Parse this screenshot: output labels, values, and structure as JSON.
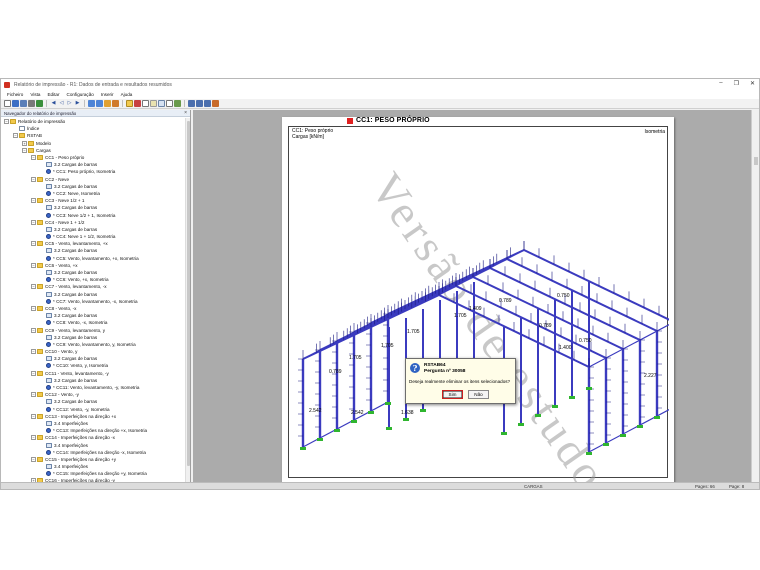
{
  "window": {
    "title": "Relatório de impressão - R1: Dados de entrada e resultados resumidos",
    "controls": [
      "–",
      "❐",
      "✕"
    ]
  },
  "menu": [
    "Ficheiro",
    "Vista",
    "Editar",
    "Configuração",
    "Inserir",
    "Ajuda"
  ],
  "navigator": {
    "title": "Navegador do relatório de impressão",
    "close": "×",
    "tree": [
      {
        "level": 0,
        "toggle": "−",
        "icon": "folder",
        "label": "Relatório de impressão"
      },
      {
        "level": 1,
        "toggle": "",
        "icon": "doc",
        "label": "Índice"
      },
      {
        "level": 1,
        "toggle": "−",
        "icon": "folder",
        "label": "RSTAB"
      },
      {
        "level": 2,
        "toggle": "+",
        "icon": "folder",
        "label": "Modelo"
      },
      {
        "level": 2,
        "toggle": "−",
        "icon": "folder",
        "label": "Cargas"
      },
      {
        "level": 3,
        "toggle": "−",
        "icon": "folder",
        "label": "CC1 - Peso próprio"
      },
      {
        "level": 4,
        "toggle": "",
        "icon": "table",
        "label": "3.2 Cargas de barras"
      },
      {
        "level": 4,
        "toggle": "",
        "icon": "iso",
        "label": "* CC1: Peso próprio, Isometria"
      },
      {
        "level": 3,
        "toggle": "−",
        "icon": "folder",
        "label": "CC2 - Neve"
      },
      {
        "level": 4,
        "toggle": "",
        "icon": "table",
        "label": "3.2 Cargas de barras"
      },
      {
        "level": 4,
        "toggle": "",
        "icon": "iso",
        "label": "* CC2: Neve, Isometria"
      },
      {
        "level": 3,
        "toggle": "−",
        "icon": "folder",
        "label": "CC3 - Neve 1/2 + 1"
      },
      {
        "level": 4,
        "toggle": "",
        "icon": "table",
        "label": "3.2 Cargas de barras"
      },
      {
        "level": 4,
        "toggle": "",
        "icon": "iso",
        "label": "* CC3: Neve 1/2 + 1, Isometria"
      },
      {
        "level": 3,
        "toggle": "−",
        "icon": "folder",
        "label": "CC4 - Neve 1 + 1/2"
      },
      {
        "level": 4,
        "toggle": "",
        "icon": "table",
        "label": "3.2 Cargas de barras"
      },
      {
        "level": 4,
        "toggle": "",
        "icon": "iso",
        "label": "* CC4: Neve 1 + 1/2, Isometria"
      },
      {
        "level": 3,
        "toggle": "−",
        "icon": "folder",
        "label": "CC5 - Vento, levantamento, +x"
      },
      {
        "level": 4,
        "toggle": "",
        "icon": "table",
        "label": "3.2 Cargas de barras"
      },
      {
        "level": 4,
        "toggle": "",
        "icon": "iso",
        "label": "* CC5: Vento, levantamento, +x, Isometria"
      },
      {
        "level": 3,
        "toggle": "−",
        "icon": "folder",
        "label": "CC6 - Vento, +x"
      },
      {
        "level": 4,
        "toggle": "",
        "icon": "table",
        "label": "3.2 Cargas de barras"
      },
      {
        "level": 4,
        "toggle": "",
        "icon": "iso",
        "label": "* CC6: Vento, +x, Isometria"
      },
      {
        "level": 3,
        "toggle": "−",
        "icon": "folder",
        "label": "CC7 - Vento, levantamento, -x"
      },
      {
        "level": 4,
        "toggle": "",
        "icon": "table",
        "label": "3.2 Cargas de barras"
      },
      {
        "level": 4,
        "toggle": "",
        "icon": "iso",
        "label": "* CC7: Vento, levantamento, -x, Isometria"
      },
      {
        "level": 3,
        "toggle": "−",
        "icon": "folder",
        "label": "CC8 - Vento, -x"
      },
      {
        "level": 4,
        "toggle": "",
        "icon": "table",
        "label": "3.2 Cargas de barras"
      },
      {
        "level": 4,
        "toggle": "",
        "icon": "iso",
        "label": "* CC8: Vento, -x, Isometria"
      },
      {
        "level": 3,
        "toggle": "−",
        "icon": "folder",
        "label": "CC9 - Vento, levantamento, y"
      },
      {
        "level": 4,
        "toggle": "",
        "icon": "table",
        "label": "3.2 Cargas de barras"
      },
      {
        "level": 4,
        "toggle": "",
        "icon": "iso",
        "label": "* CC9: Vento, levantamento, y, Isometria"
      },
      {
        "level": 3,
        "toggle": "−",
        "icon": "folder",
        "label": "CC10 - Vento, y"
      },
      {
        "level": 4,
        "toggle": "",
        "icon": "table",
        "label": "3.2 Cargas de barras"
      },
      {
        "level": 4,
        "toggle": "",
        "icon": "iso",
        "label": "* CC10: Vento, y, Isometria"
      },
      {
        "level": 3,
        "toggle": "−",
        "icon": "folder",
        "label": "CC11 - Vento, levantamento, -y"
      },
      {
        "level": 4,
        "toggle": "",
        "icon": "table",
        "label": "3.2 Cargas de barras"
      },
      {
        "level": 4,
        "toggle": "",
        "icon": "iso",
        "label": "* CC11: Vento, levantamento, -y, Isometria"
      },
      {
        "level": 3,
        "toggle": "−",
        "icon": "folder",
        "label": "CC12 - Vento, -y"
      },
      {
        "level": 4,
        "toggle": "",
        "icon": "table",
        "label": "3.2 Cargas de barras"
      },
      {
        "level": 4,
        "toggle": "",
        "icon": "iso",
        "label": "* CC12: Vento, -y, Isometria"
      },
      {
        "level": 3,
        "toggle": "−",
        "icon": "folder",
        "label": "CC13 - Imperfeições na direção +x"
      },
      {
        "level": 4,
        "toggle": "",
        "icon": "table",
        "label": "3.4 Imperfeições"
      },
      {
        "level": 4,
        "toggle": "",
        "icon": "iso",
        "label": "* CC13: Imperfeições na direção +x, Isometria"
      },
      {
        "level": 3,
        "toggle": "−",
        "icon": "folder",
        "label": "CC14 - Imperfeições na direção -x"
      },
      {
        "level": 4,
        "toggle": "",
        "icon": "table",
        "label": "3.4 Imperfeições"
      },
      {
        "level": 4,
        "toggle": "",
        "icon": "iso",
        "label": "* CC14: Imperfeições na direção -x, Isometria"
      },
      {
        "level": 3,
        "toggle": "−",
        "icon": "folder",
        "label": "CC15 - Imperfeições na direção +y"
      },
      {
        "level": 4,
        "toggle": "",
        "icon": "table",
        "label": "3.4 Imperfeições"
      },
      {
        "level": 4,
        "toggle": "",
        "icon": "iso",
        "label": "* CC15: Imperfeições na direção +y, Isometria"
      },
      {
        "level": 3,
        "toggle": "+",
        "icon": "folder",
        "label": "CC16 - Imperfeições na direção -y"
      }
    ]
  },
  "page": {
    "header": "CC1: PESO PRÓPRIO",
    "box_title_1": "CC1: Peso próprio",
    "box_title_2": "Cargas [kN/m]",
    "isometry": "Isometria",
    "watermark": "Versão de estudo",
    "load_labels": [
      "0.750",
      "0.789",
      "1.409",
      "1.705",
      "1.705",
      "1.705",
      "1.705",
      "0.789",
      "0.789",
      "0.750",
      "1.400",
      "2.227",
      "2.542",
      "2.542",
      "1.638"
    ]
  },
  "dialog": {
    "title": "RSTAB64",
    "subtitle": "Pergunta nº 30058",
    "message": "Deseja realmente eliminar os itens selecionados?",
    "yes": "Sim",
    "no": "Não"
  },
  "status": {
    "center": "CARGAS",
    "pages": "Pages: 66",
    "page": "Page: 8"
  },
  "colors": {
    "structure": "#3b3bbf",
    "load_arrows": "#1a1a80",
    "supports": "#2fb52f",
    "header_mark": "#e02020"
  }
}
